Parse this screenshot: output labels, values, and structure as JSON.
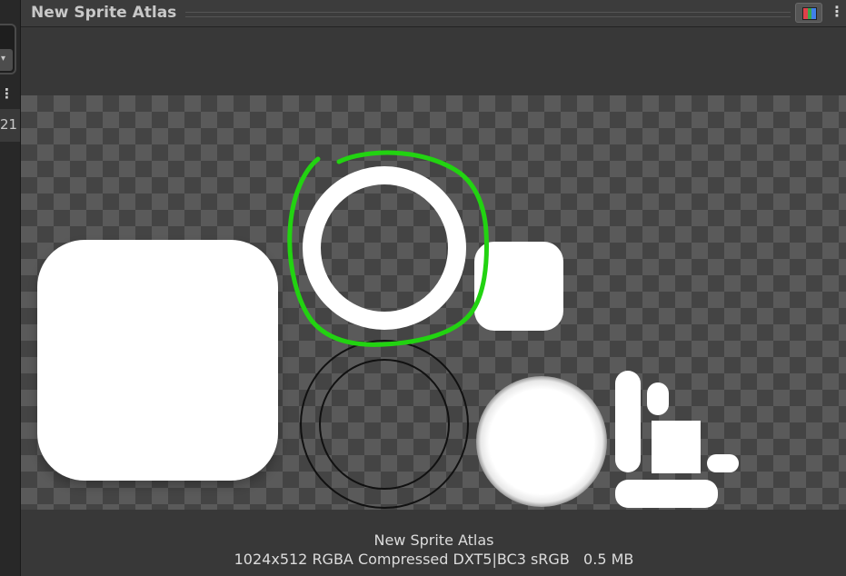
{
  "left_panel": {
    "dropdown_arrow": "▾",
    "menu_glyph": "⋮",
    "partial_value": "21"
  },
  "window": {
    "title": "New Sprite Atlas",
    "channel_button_icon": "rgb-channels-icon",
    "menu_icon": "kebab-menu-icon",
    "menu_glyph": "⋮"
  },
  "preview": {
    "background": "checkerboard",
    "sprites": [
      "rounded-square-large",
      "ring-thick",
      "rounded-square-small",
      "ring-outline",
      "soft-circle",
      "small-ui-pieces"
    ],
    "highlight_annotation": {
      "color": "#22d311",
      "target": "ring-thick"
    }
  },
  "footer": {
    "asset_name": "New Sprite Atlas",
    "texture_info": "1024x512 RGBA Compressed DXT5|BC3 sRGB   0.5 MB"
  },
  "colors": {
    "panel_bg": "#383838",
    "checker_dark": "#444444",
    "checker_light": "#5a5a5a",
    "annotation_green": "#22d311"
  }
}
